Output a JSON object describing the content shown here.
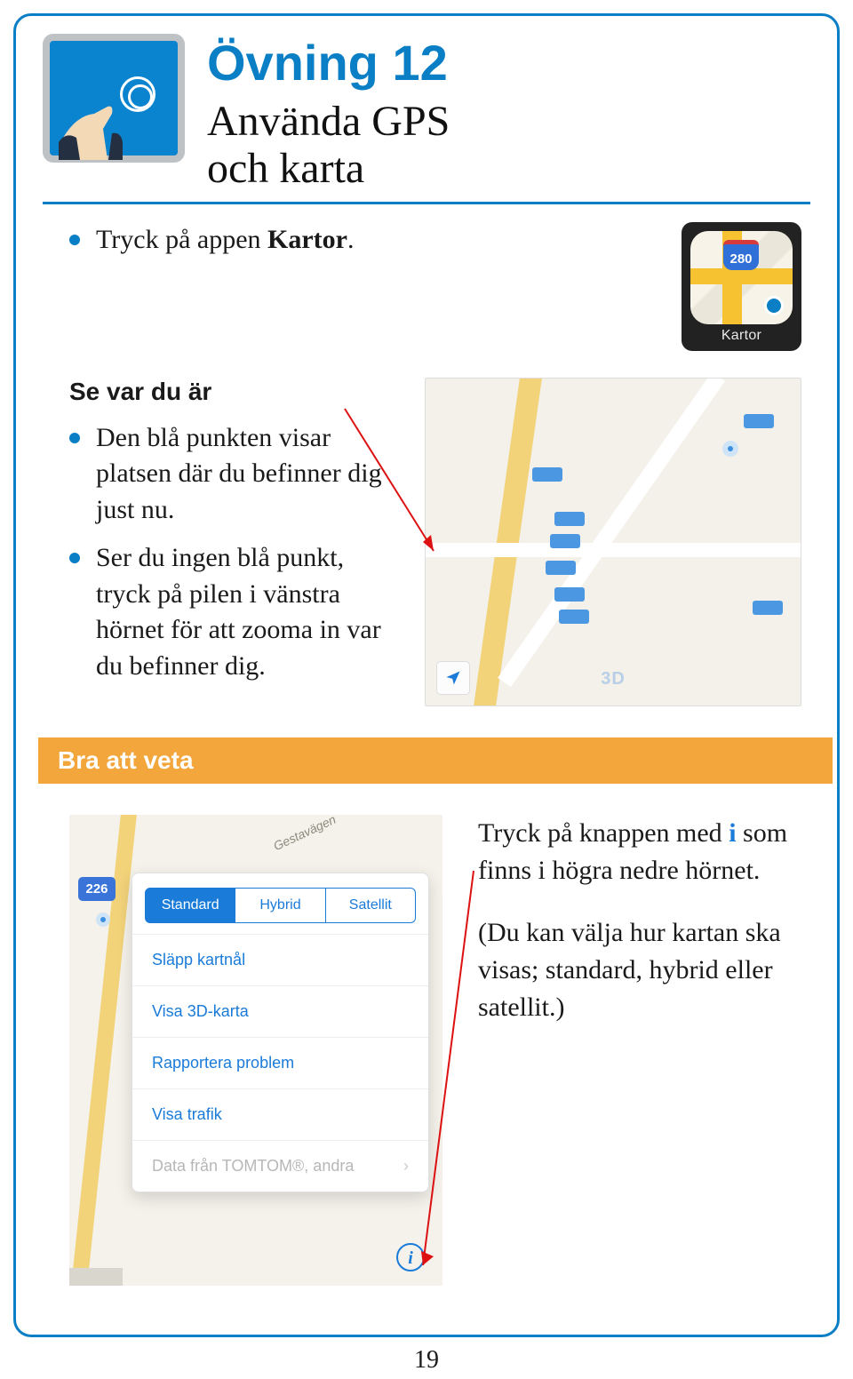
{
  "header": {
    "exercise_label": "Övning 12",
    "subtitle_line1": "Använda GPS",
    "subtitle_line2": "och karta"
  },
  "step1": {
    "prefix": "Tryck på appen ",
    "bold": "Kartor",
    "suffix": "."
  },
  "kartor_app": {
    "label": "Kartor",
    "shield_text": "280"
  },
  "section1": {
    "heading": "Se var du är",
    "bullet1": "Den blå punkten visar platsen där du befinner dig just nu.",
    "bullet2": "Ser du ingen blå punkt, tryck på pilen i vänstra hörnet för att zooma in var du befinner dig."
  },
  "map1": {
    "three_d_label": "3D"
  },
  "info_banner": "Bra att veta",
  "menu_sheet": {
    "road_label": "Gestavägen",
    "shield": "226",
    "segments": [
      "Standard",
      "Hybrid",
      "Satellit"
    ],
    "selected_index": 0,
    "items": [
      "Släpp kartnål",
      "Visa 3D-karta",
      "Rapportera problem",
      "Visa trafik"
    ],
    "footer": "Data från TOMTOM®, andra",
    "footer_chevron": "›",
    "info_glyph": "i"
  },
  "row3_text": {
    "p1_pre": "Tryck på knappen med ",
    "p1_letter": "i",
    "p1_post": " som finns i högra nedre hörnet.",
    "p2": "(Du kan välja hur kartan ska visas; standard, hybrid eller satellit.)"
  },
  "page_number": "19"
}
